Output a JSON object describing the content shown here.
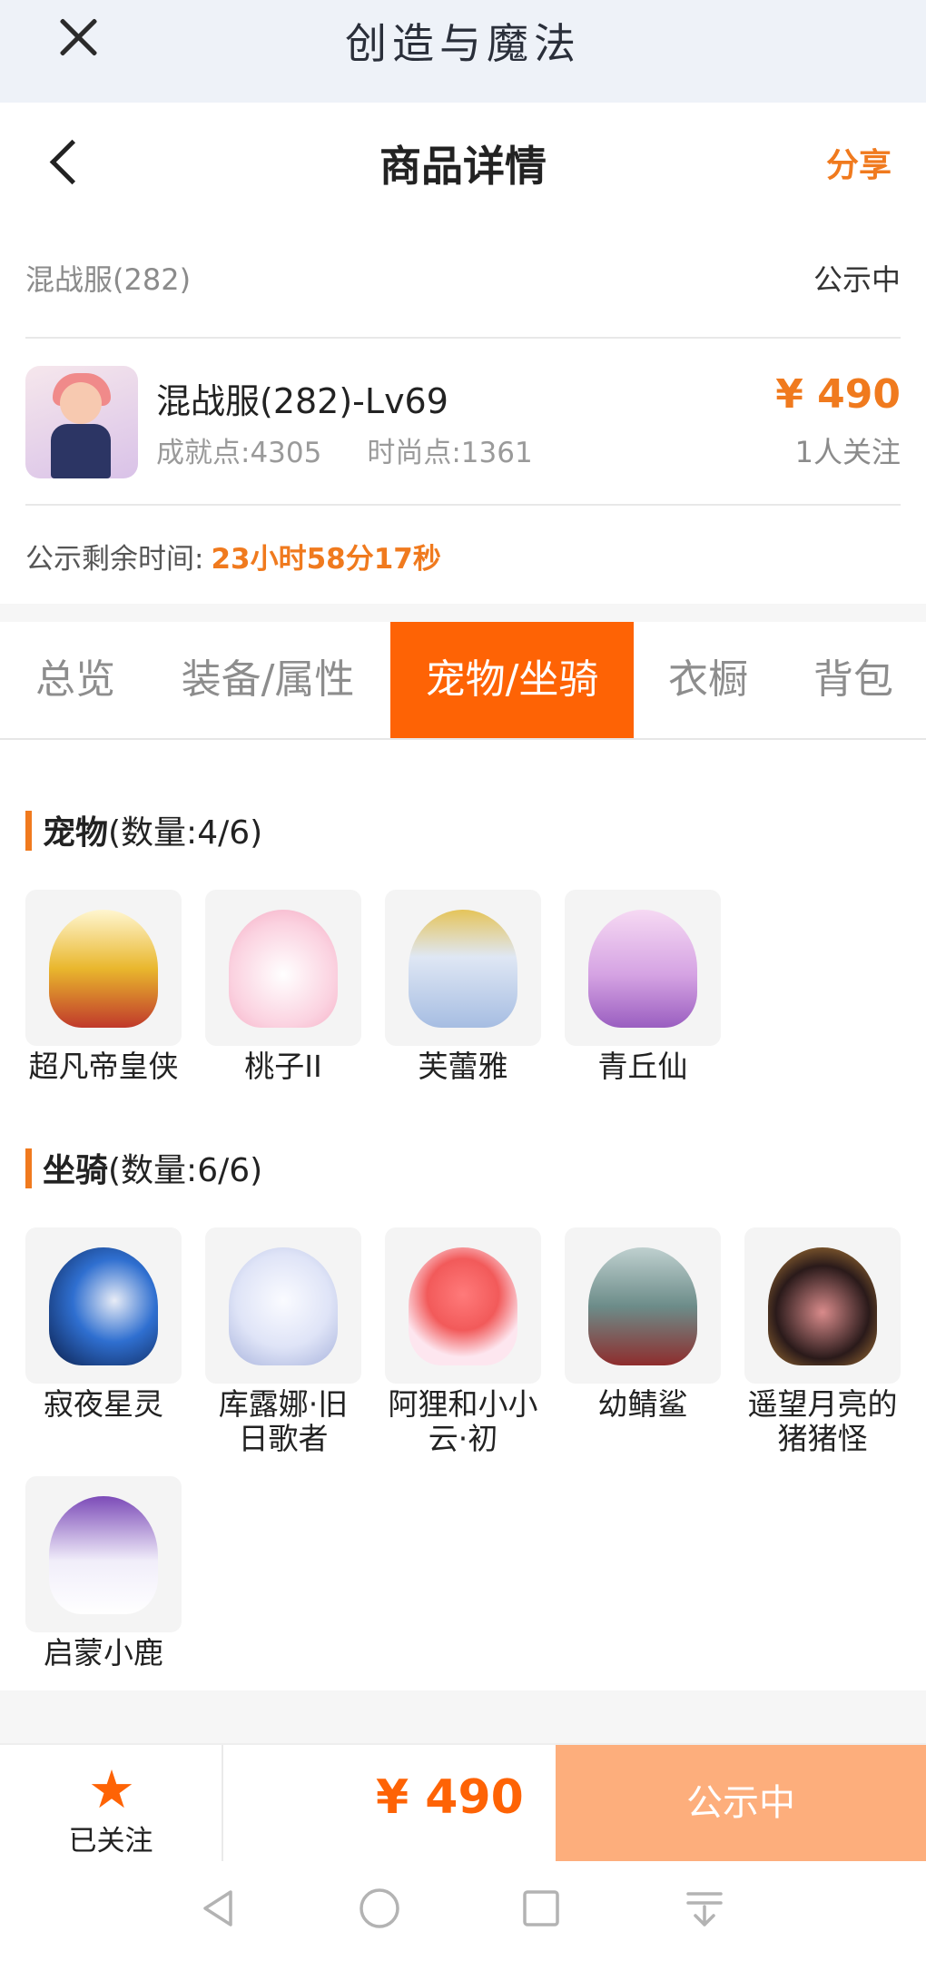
{
  "appbar": {
    "title": "创造与魔法"
  },
  "header": {
    "title": "商品详情",
    "share": "分享"
  },
  "server": {
    "name": "混战服(282)",
    "status": "公示中"
  },
  "item": {
    "title": "混战服(282)-Lv69",
    "achievement": "成就点:4305",
    "fashion": "时尚点:1361",
    "price": "¥ 490",
    "followers": "1人关注"
  },
  "remain": {
    "label": "公示剩余时间:",
    "time": "23小时58分17秒"
  },
  "tabs": [
    {
      "label": "总览"
    },
    {
      "label": "装备/属性"
    },
    {
      "label": "宠物/坐骑"
    },
    {
      "label": "衣橱"
    },
    {
      "label": "背包"
    }
  ],
  "pets": {
    "title": "宠物",
    "count": "(数量:4/6)",
    "items": [
      {
        "name": "超凡帝皇侠"
      },
      {
        "name": "桃子II"
      },
      {
        "name": "芙蕾雅"
      },
      {
        "name": "青丘仙"
      }
    ]
  },
  "mounts": {
    "title": "坐骑",
    "count": "(数量:6/6)",
    "items": [
      {
        "name": "寂夜星灵"
      },
      {
        "name": "库露娜·旧日歌者"
      },
      {
        "name": "阿狸和小小云·初"
      },
      {
        "name": "幼鲭鲨"
      },
      {
        "name": "遥望月亮的猪猪怪"
      },
      {
        "name": "启蒙小鹿"
      }
    ]
  },
  "bottom": {
    "follow": "已关注",
    "price": "¥ 490",
    "status": "公示中"
  },
  "colors": {
    "accent": "#fe6305",
    "price": "#f07a1e",
    "status_button": "#fdae7c"
  },
  "icons": [
    "close-icon",
    "back-icon",
    "star-icon",
    "nav-back-icon",
    "nav-home-icon",
    "nav-recent-icon",
    "nav-menu-icon"
  ]
}
